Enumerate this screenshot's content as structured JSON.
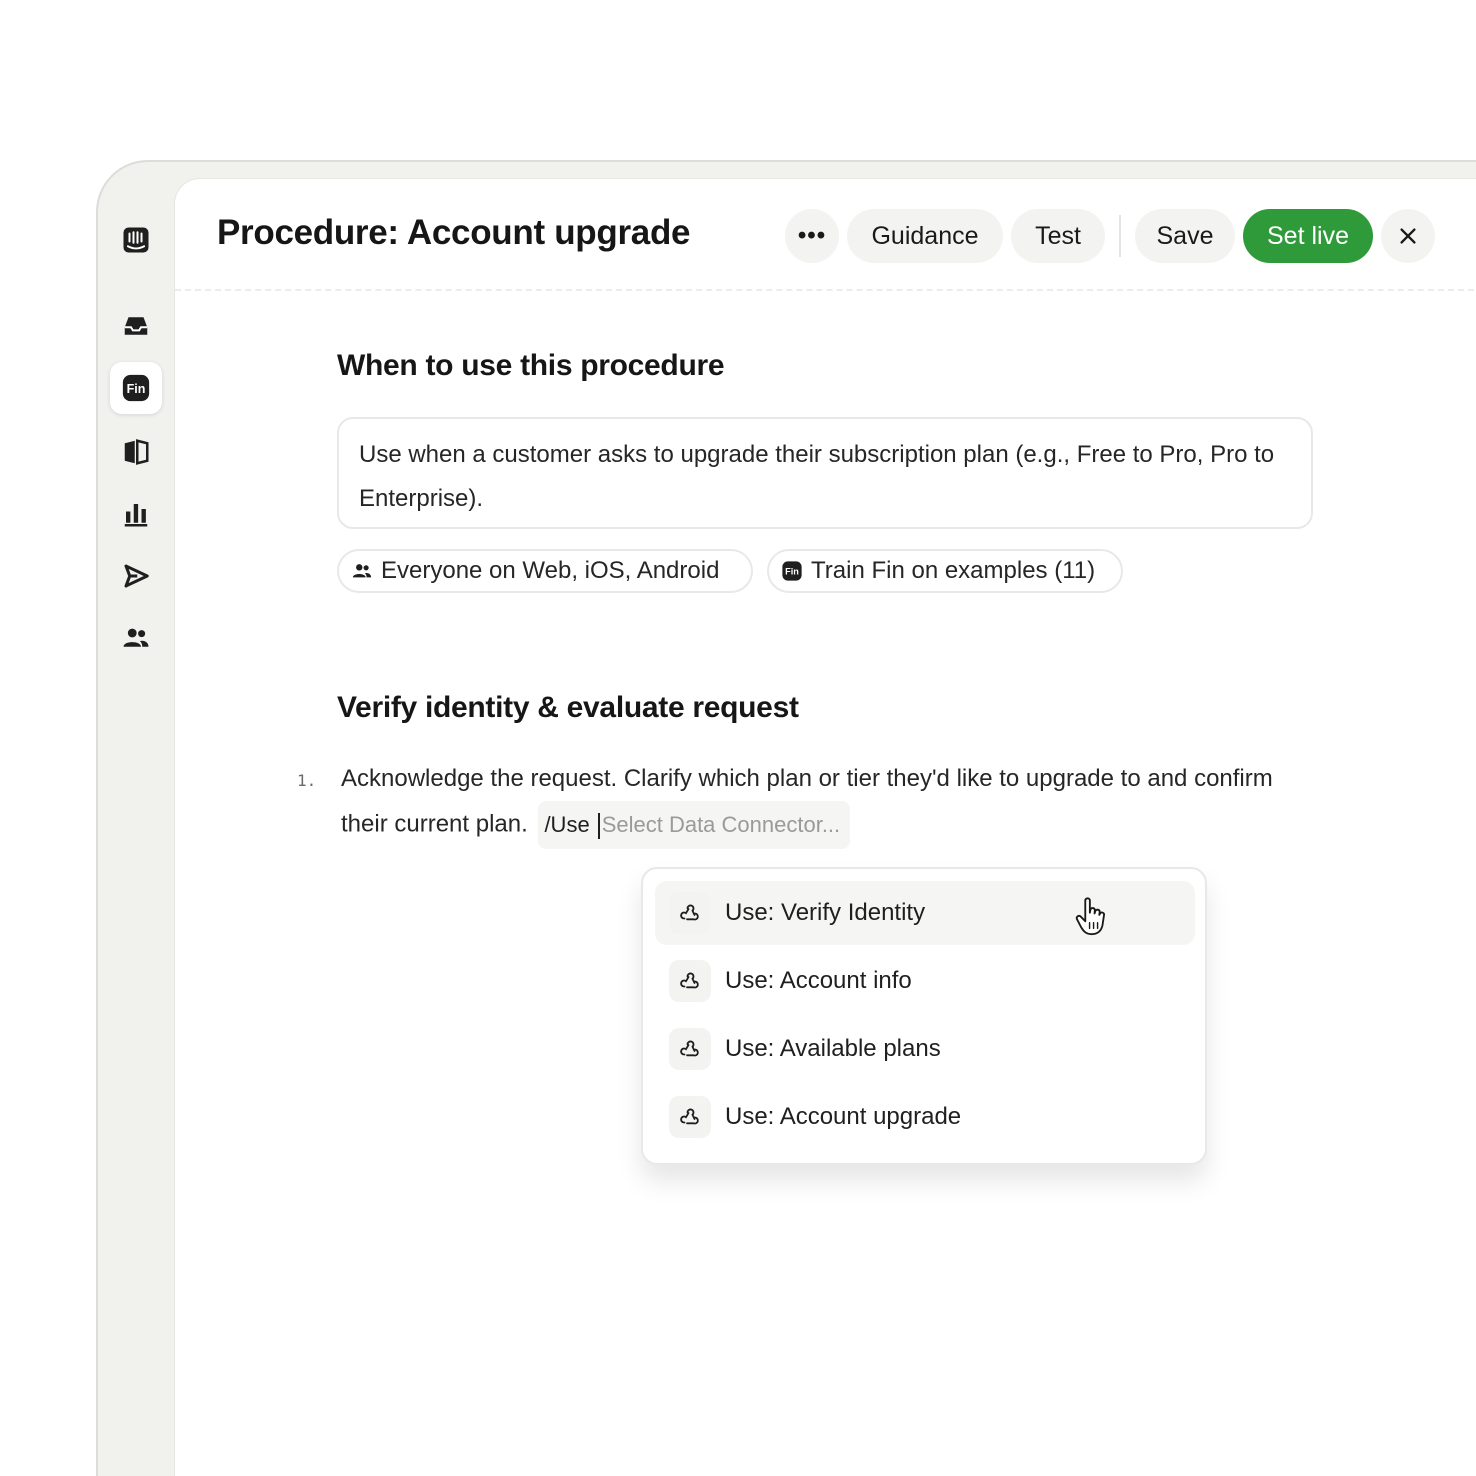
{
  "header": {
    "title": "Procedure: Account upgrade",
    "more_label": "•••",
    "guidance_label": "Guidance",
    "test_label": "Test",
    "save_label": "Save",
    "set_live_label": "Set live",
    "accent_color": "#2e9a3a"
  },
  "sidebar": {
    "items": [
      {
        "icon": "intercom-logo-icon",
        "active": false
      },
      {
        "icon": "inbox-icon",
        "active": false
      },
      {
        "icon": "fin-icon",
        "label": "Fin",
        "active": true
      },
      {
        "icon": "knowledge-book-icon",
        "active": false
      },
      {
        "icon": "reports-chart-icon",
        "active": false
      },
      {
        "icon": "outbound-send-icon",
        "active": false
      },
      {
        "icon": "contacts-people-icon",
        "active": false
      }
    ]
  },
  "when_section": {
    "title": "When to use this procedure",
    "description": "Use when a customer asks to upgrade their subscription plan (e.g., Free to Pro, Pro to Enterprise).",
    "chips": {
      "audience": "Everyone on Web, iOS, Android",
      "train_fin_icon": "Fin",
      "train": "Train Fin on examples (11)"
    }
  },
  "verify_section": {
    "title": "Verify identity & evaluate request",
    "steps": [
      {
        "number": "1.",
        "text": "Acknowledge the request. Clarify which plan or tier they'd like to upgrade to and confirm their current plan.",
        "slash_command": "/Use",
        "connector_placeholder": "Select Data Connector..."
      }
    ]
  },
  "connector_menu": {
    "items": [
      {
        "label": "Use: Verify Identity",
        "icon": "webhook-icon",
        "hovered": true
      },
      {
        "label": "Use: Account info",
        "icon": "webhook-icon",
        "hovered": false
      },
      {
        "label": "Use: Available plans",
        "icon": "webhook-icon",
        "hovered": false
      },
      {
        "label": "Use: Account upgrade",
        "icon": "webhook-icon",
        "hovered": false
      }
    ]
  }
}
